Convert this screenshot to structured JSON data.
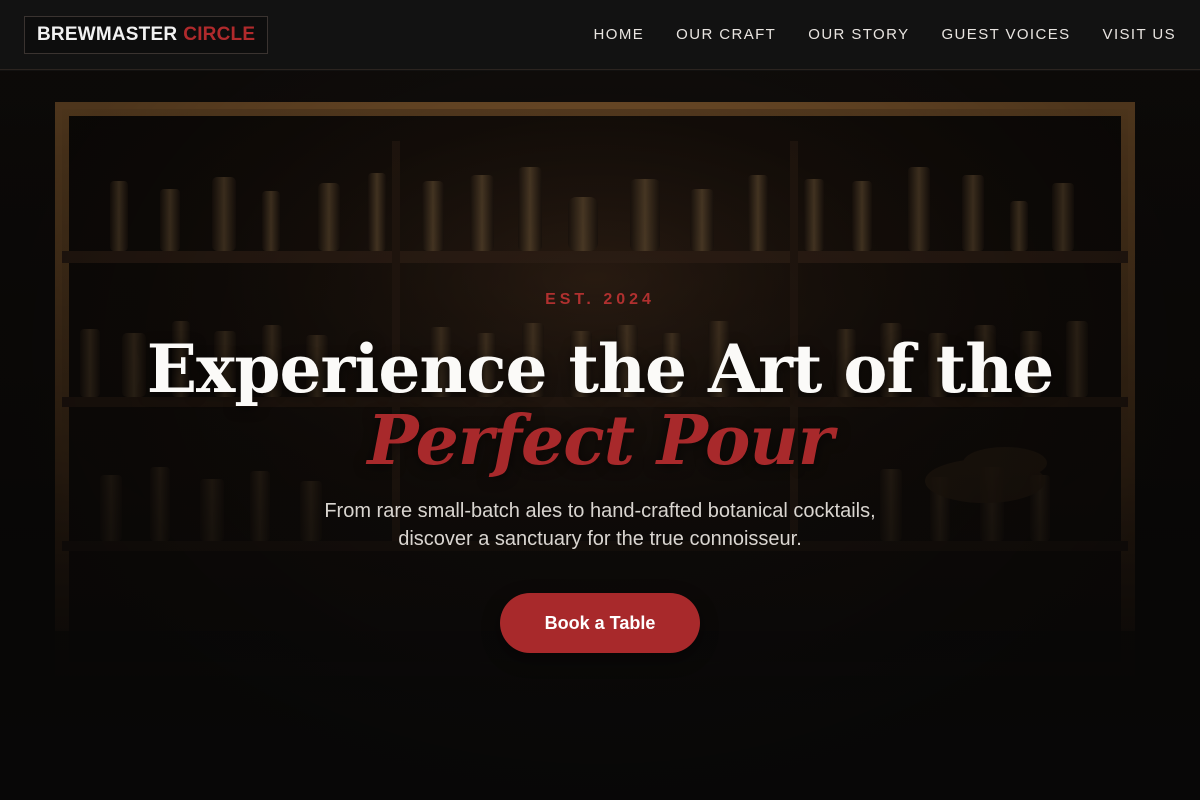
{
  "brand": {
    "name_primary": "BREWMASTER",
    "name_accent": "CIRCLE"
  },
  "nav": {
    "items": [
      {
        "label": "HOME"
      },
      {
        "label": "OUR CRAFT"
      },
      {
        "label": "OUR STORY"
      },
      {
        "label": "GUEST VOICES"
      },
      {
        "label": "VISIT US"
      }
    ]
  },
  "hero": {
    "eyebrow": "EST. 2024",
    "title_line1": "Experience the Art of the",
    "title_accent": "Perfect Pour",
    "subtitle_line1": "From rare small-batch ales to hand-crafted botanical cocktails,",
    "subtitle_line2": "discover a sanctuary for the true connoisseur.",
    "cta_label": "Book a Table"
  },
  "colors": {
    "accent": "#a8292b",
    "background": "#121212",
    "text": "#fbfaf8"
  }
}
